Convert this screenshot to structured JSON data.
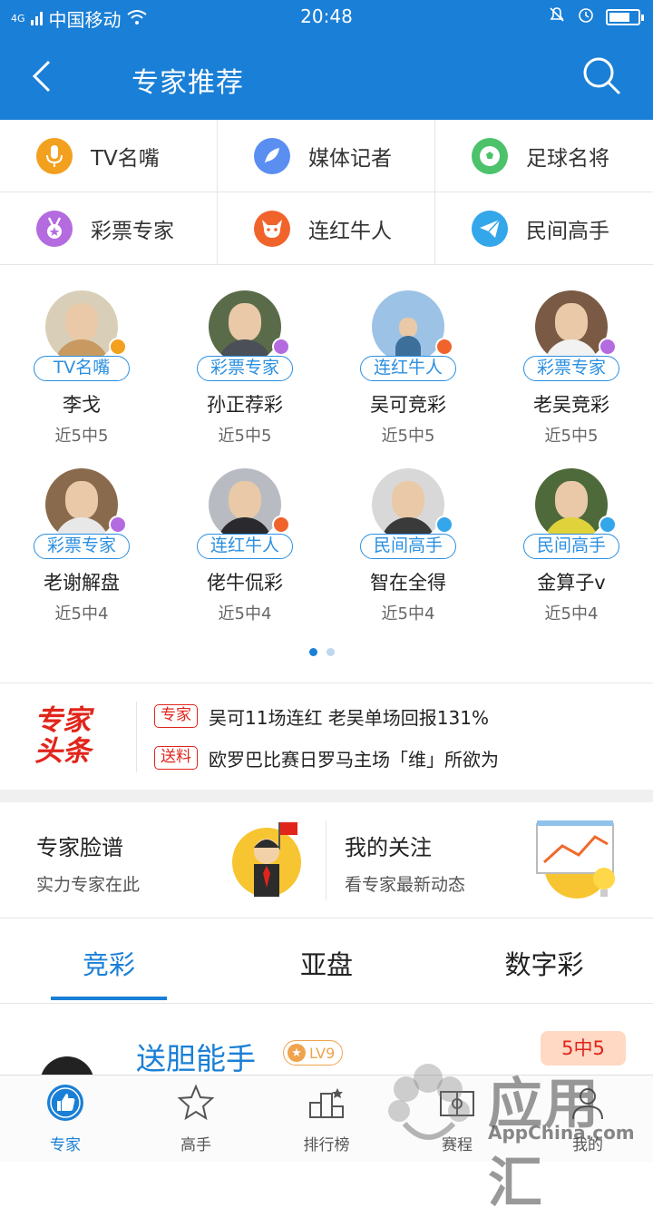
{
  "status_bar": {
    "carrier": "中国移动",
    "network": "4G",
    "time": "20:48"
  },
  "header": {
    "title": "专家推荐"
  },
  "categories": [
    {
      "label": "TV名嘴",
      "icon": "microphone-icon",
      "color": "#f2a01e"
    },
    {
      "label": "媒体记者",
      "icon": "feather-icon",
      "color": "#5a8ef0"
    },
    {
      "label": "足球名将",
      "icon": "soccer-ball-icon",
      "color": "#4cc26b"
    },
    {
      "label": "彩票专家",
      "icon": "medal-icon",
      "color": "#b46be0"
    },
    {
      "label": "连红牛人",
      "icon": "bull-icon",
      "color": "#f0642c"
    },
    {
      "label": "民间高手",
      "icon": "paper-plane-icon",
      "color": "#34a6ea"
    }
  ],
  "experts": [
    {
      "tag": "TV名嘴",
      "name": "李戈",
      "record": "近5中5",
      "badge_color": "#f2a01e"
    },
    {
      "tag": "彩票专家",
      "name": "孙正荐彩",
      "record": "近5中5",
      "badge_color": "#b46be0"
    },
    {
      "tag": "连红牛人",
      "name": "吴可竞彩",
      "record": "近5中5",
      "badge_color": "#f0642c"
    },
    {
      "tag": "彩票专家",
      "name": "老吴竞彩",
      "record": "近5中5",
      "badge_color": "#b46be0"
    },
    {
      "tag": "彩票专家",
      "name": "老谢解盘",
      "record": "近5中4",
      "badge_color": "#b46be0"
    },
    {
      "tag": "连红牛人",
      "name": "佬牛侃彩",
      "record": "近5中4",
      "badge_color": "#f0642c"
    },
    {
      "tag": "民间高手",
      "name": "智在全得",
      "record": "近5中4",
      "badge_color": "#34a6ea"
    },
    {
      "tag": "民间高手",
      "name": "金算子v",
      "record": "近5中4",
      "badge_color": "#34a6ea"
    }
  ],
  "headlines": {
    "logo_line1": "专家",
    "logo_line2": "头条",
    "items": [
      {
        "badge": "专家",
        "text": "吴可11场连红 老吴单场回报131%"
      },
      {
        "badge": "送料",
        "text": "欧罗巴比赛日罗马主场「维」所欲为"
      }
    ]
  },
  "promos": [
    {
      "title": "专家脸谱",
      "subtitle": "实力专家在此",
      "icon": "expert-figure-icon"
    },
    {
      "title": "我的关注",
      "subtitle": "看专家最新动态",
      "icon": "chart-board-icon"
    }
  ],
  "tabs": [
    {
      "label": "竞彩"
    },
    {
      "label": "亚盘"
    },
    {
      "label": "数字彩"
    }
  ],
  "list_item": {
    "name": "送胆能手",
    "level": "LV9",
    "score": "5中5"
  },
  "bottom_nav": [
    {
      "label": "专家",
      "icon": "thumbs-up-icon"
    },
    {
      "label": "高手",
      "icon": "star-icon"
    },
    {
      "label": "排行榜",
      "icon": "podium-icon"
    },
    {
      "label": "赛程",
      "icon": "pitch-icon"
    },
    {
      "label": "我的",
      "icon": "user-icon"
    }
  ],
  "watermark": {
    "brand": "应用汇",
    "domain": "AppChina.com"
  },
  "colors": {
    "primary": "#1a7fd6",
    "accent_red": "#e1251b",
    "level_orange": "#f0a34d"
  }
}
